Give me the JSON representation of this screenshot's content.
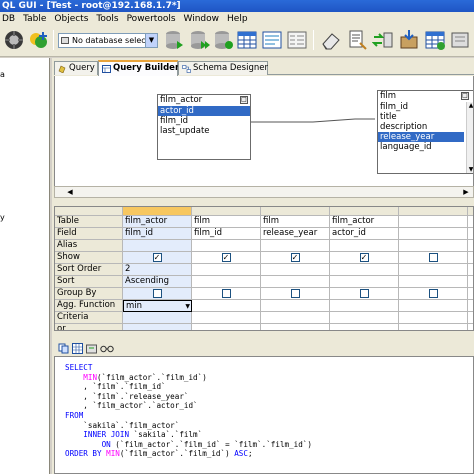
{
  "window": {
    "title": "QL GUI - [Test - root@192.168.1.7*]"
  },
  "menu": [
    "DB",
    "Table",
    "Objects",
    "Tools",
    "Powertools",
    "Window",
    "Help"
  ],
  "toolbar": {
    "db_selector": "No database selected"
  },
  "left_panel": {
    "labels": [
      "a",
      "y"
    ]
  },
  "tabs": [
    {
      "label": "Query",
      "active": false
    },
    {
      "label": "Query Builder",
      "active": true
    },
    {
      "label": "Schema Designer",
      "active": false
    }
  ],
  "diagram": {
    "tables": [
      {
        "name": "film_actor",
        "fields": [
          "actor_id",
          "film_id",
          "last_update"
        ],
        "selected": 0
      },
      {
        "name": "film",
        "fields": [
          "film_id",
          "title",
          "description",
          "release_year",
          "language_id"
        ],
        "selected": 3
      }
    ]
  },
  "grid": {
    "row_headers": [
      "Table",
      "Field",
      "Alias",
      "Show",
      "Sort Order",
      "Sort",
      "Group By",
      "Agg. Function",
      "Criteria",
      "or"
    ],
    "columns": [
      {
        "table": "film_actor",
        "field": "film_id",
        "show": true,
        "sort_order": "2",
        "sort": "Ascending",
        "group_by": false,
        "agg": "min"
      },
      {
        "table": "film",
        "field": "film_id",
        "show": true,
        "sort_order": "",
        "sort": "",
        "group_by": false,
        "agg": ""
      },
      {
        "table": "film",
        "field": "release_year",
        "show": true,
        "sort_order": "",
        "sort": "",
        "group_by": false,
        "agg": ""
      },
      {
        "table": "film_actor",
        "field": "actor_id",
        "show": true,
        "sort_order": "",
        "sort": "",
        "group_by": false,
        "agg": ""
      },
      {
        "table": "",
        "field": "",
        "show": false,
        "sort_order": "",
        "sort": "",
        "group_by": false,
        "agg": ""
      }
    ]
  },
  "sql_lines": [
    [
      [
        "kw",
        "SELECT"
      ]
    ],
    [
      [
        "sym",
        "    "
      ],
      [
        "fn",
        "MIN"
      ],
      [
        "sym",
        "("
      ],
      [
        "str",
        "`film_actor`"
      ],
      [
        "sym",
        "."
      ],
      [
        "str",
        "`film_id`"
      ],
      [
        "sym",
        ")"
      ]
    ],
    [
      [
        "sym",
        "    , "
      ],
      [
        "str",
        "`film`"
      ],
      [
        "sym",
        "."
      ],
      [
        "str",
        "`film_id`"
      ]
    ],
    [
      [
        "sym",
        "    , "
      ],
      [
        "str",
        "`film`"
      ],
      [
        "sym",
        "."
      ],
      [
        "str",
        "`release_year`"
      ]
    ],
    [
      [
        "sym",
        "    , "
      ],
      [
        "str",
        "`film_actor`"
      ],
      [
        "sym",
        "."
      ],
      [
        "str",
        "`actor_id`"
      ]
    ],
    [
      [
        "kw",
        "FROM"
      ]
    ],
    [
      [
        "sym",
        "    "
      ],
      [
        "str",
        "`sakila`"
      ],
      [
        "sym",
        "."
      ],
      [
        "str",
        "`film_actor`"
      ]
    ],
    [
      [
        "sym",
        "    "
      ],
      [
        "kw",
        "INNER JOIN"
      ],
      [
        "sym",
        " "
      ],
      [
        "str",
        "`sakila`"
      ],
      [
        "sym",
        "."
      ],
      [
        "str",
        "`film`"
      ]
    ],
    [
      [
        "sym",
        "        "
      ],
      [
        "kw",
        "ON"
      ],
      [
        "sym",
        " ("
      ],
      [
        "str",
        "`film_actor`"
      ],
      [
        "sym",
        "."
      ],
      [
        "str",
        "`film_id`"
      ],
      [
        "sym",
        " = "
      ],
      [
        "str",
        "`film`"
      ],
      [
        "sym",
        "."
      ],
      [
        "str",
        "`film_id`"
      ],
      [
        "sym",
        ")"
      ]
    ],
    [
      [
        "kw",
        "ORDER BY"
      ],
      [
        "sym",
        " "
      ],
      [
        "fn",
        "MIN"
      ],
      [
        "sym",
        "("
      ],
      [
        "str",
        "`film_actor`"
      ],
      [
        "sym",
        "."
      ],
      [
        "str",
        "`film_id`"
      ],
      [
        "sym",
        ") "
      ],
      [
        "kw",
        "ASC"
      ],
      [
        "sym",
        ";"
      ]
    ]
  ]
}
